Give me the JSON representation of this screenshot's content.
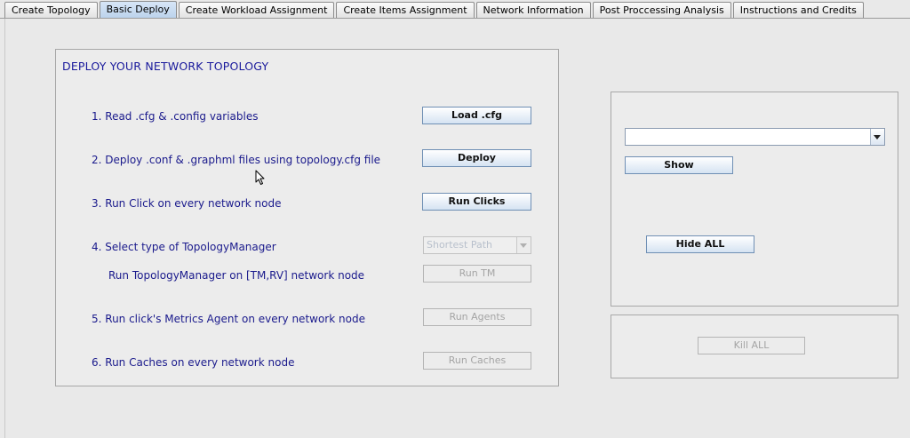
{
  "tabs": [
    {
      "label": "Create Topology",
      "active": false
    },
    {
      "label": "Basic Deploy",
      "active": true
    },
    {
      "label": "Create Workload Assignment",
      "active": false
    },
    {
      "label": "Create Items Assignment",
      "active": false
    },
    {
      "label": "Network Information",
      "active": false
    },
    {
      "label": "Post Proccessing Analysis",
      "active": false
    },
    {
      "label": "Instructions and Credits",
      "active": false
    }
  ],
  "deploy": {
    "title": "DEPLOY YOUR NETWORK TOPOLOGY",
    "steps": [
      {
        "label": "1.  Read .cfg & .config variables",
        "button": "Load .cfg",
        "enabled": true
      },
      {
        "label": "2.  Deploy .conf & .graphml files using topology.cfg file",
        "button": "Deploy",
        "enabled": true
      },
      {
        "label": "3.  Run Click on every network node",
        "button": "Run Clicks",
        "enabled": true
      },
      {
        "label": "4.  Select type of TopologyManager",
        "select_value": "Shortest Path",
        "enabled": false
      },
      {
        "label": "Run TopologyManager on [TM,RV] network node",
        "button": "Run TM",
        "enabled": false
      },
      {
        "label": "5. Run click's Metrics Agent on every network node",
        "button": "Run Agents",
        "enabled": false
      },
      {
        "label": "6. Run Caches on every network node",
        "button": "Run Caches",
        "enabled": false
      }
    ]
  },
  "right_panel": {
    "select_value": "",
    "show_button": "Show",
    "hide_all_button": "Hide ALL"
  },
  "kill_panel": {
    "kill_all_button": "Kill ALL",
    "enabled": false
  },
  "colors": {
    "label_text": "#1a1a8c",
    "active_tab": "#c6d9ef",
    "button_border": "#6f8fb4",
    "background": "#e9e9e9"
  }
}
